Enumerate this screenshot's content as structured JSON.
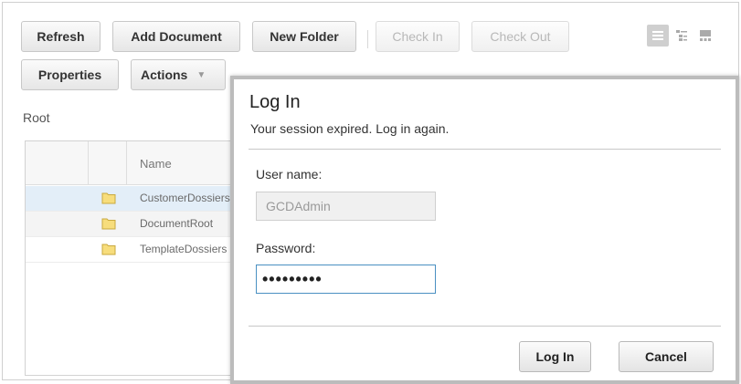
{
  "toolbar": {
    "refresh": "Refresh",
    "add_document": "Add Document",
    "new_folder": "New Folder",
    "check_in": "Check In",
    "check_out": "Check Out",
    "properties": "Properties",
    "actions": "Actions",
    "actions_caret": "▼"
  },
  "view_modes": [
    "details-view-icon",
    "tree-view-icon",
    "thumbnail-view-icon"
  ],
  "breadcrumb": "Root",
  "grid": {
    "name_header": "Name",
    "rows": [
      {
        "name": "CustomerDossiers",
        "icon": "folder-icon"
      },
      {
        "name": "DocumentRoot",
        "icon": "folder-icon"
      },
      {
        "name": "TemplateDossiers",
        "icon": "folder-icon"
      }
    ]
  },
  "login_dialog": {
    "title": "Log In",
    "subtitle": "Your session expired. Log in again.",
    "username_label": "User name:",
    "username_value": "GCDAdmin",
    "password_label": "Password:",
    "password_value": "•••••••••",
    "login_button": "Log In",
    "cancel_button": "Cancel"
  },
  "colors": {
    "selected_row": "#e3eef8",
    "focus_border": "#4a90c2",
    "folder": "#f5d76e"
  }
}
